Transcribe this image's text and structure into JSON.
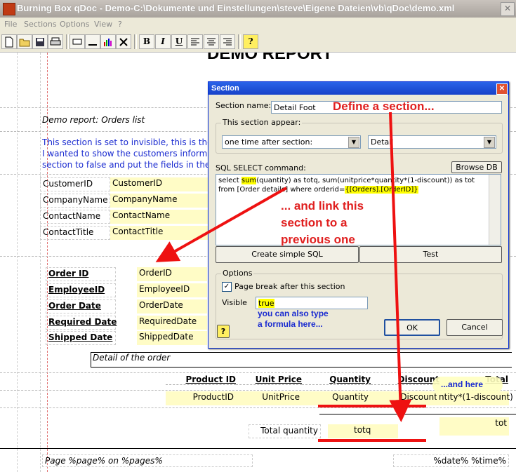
{
  "window": {
    "title": "Burning Box qDoc - Demo-C:\\Dokumente und Einstellungen\\steve\\Eigene Dateien\\vb\\qDoc\\demo.xml",
    "close": "✕"
  },
  "menu": [
    "File",
    "Sections",
    "Options",
    "View",
    "?"
  ],
  "toolbar": {
    "bold": "B",
    "italic": "I",
    "underline": "U",
    "help": "?"
  },
  "report": {
    "demo_title": "DEMO REPORT",
    "subtitle": "Demo report: Orders list",
    "invisible_note": [
      "This section is set to invisible, this is the",
      "I wanted to show the customers informati",
      "section to false and put the fields in the b"
    ],
    "customer_rows": [
      {
        "label": "CustomerID",
        "field": "CustomerID"
      },
      {
        "label": "CompanyName",
        "field": "CompanyName"
      },
      {
        "label": "ContactName",
        "field": "ContactName"
      },
      {
        "label": "ContactTitle",
        "field": "ContactTitle"
      }
    ],
    "order_rows": [
      {
        "label": "Order ID",
        "field": "OrderID"
      },
      {
        "label": "EmployeeID",
        "field": "EmployeeID"
      },
      {
        "label": "Order Date",
        "field": "OrderDate"
      },
      {
        "label": "Required Date",
        "field": "RequiredDate"
      },
      {
        "label": "Shipped Date",
        "field": "ShippedDate"
      }
    ],
    "detail_caption": "Detail of the order",
    "detail_headers": {
      "product_id": "Product ID",
      "unit_price": "Unit Price",
      "quantity": "Quantity",
      "discount": "Discount",
      "total": "Total"
    },
    "detail_fields": {
      "product_id": "ProductID",
      "unit_price": "UnitPrice",
      "quantity": "Quantity",
      "discount": "Discount",
      "formula": "ntity*(1-discount)"
    },
    "total_label": "Total quantity",
    "total_field": "totq",
    "tot_field": "tot",
    "footer_page": "Page %page% on %pages%",
    "footer_date": "%date% %time%"
  },
  "dialog": {
    "title": "Section",
    "section_name_label": "Section name:",
    "section_name_value": "Detail Foot",
    "appear_group": "This section appear:",
    "appear_value": "one time after section:",
    "after_section_value": "Detail",
    "sql_label": "SQL SELECT command:",
    "browse_db": "Browse DB",
    "sql": {
      "p1": "select ",
      "hl1": "sum",
      "p2": "(quantity) as totq, sum(unitprice*quantity*(1-discount)) as tot from [Order details] where orderid=",
      "hl2": "{[Orders].[OrderID]}"
    },
    "create_sql": "Create simple SQL",
    "test": "Test",
    "options_group": "Options",
    "page_break": "Page break after this section",
    "visible_label": "Visible",
    "visible_value": "true",
    "ok": "OK",
    "cancel": "Cancel",
    "help": "?"
  },
  "annotations": {
    "define": "Define a section...",
    "link": [
      "... and link this",
      "section to a",
      "previous one"
    ],
    "formula": [
      "you can also type",
      "a formula here..."
    ],
    "and_here": "...and here"
  }
}
